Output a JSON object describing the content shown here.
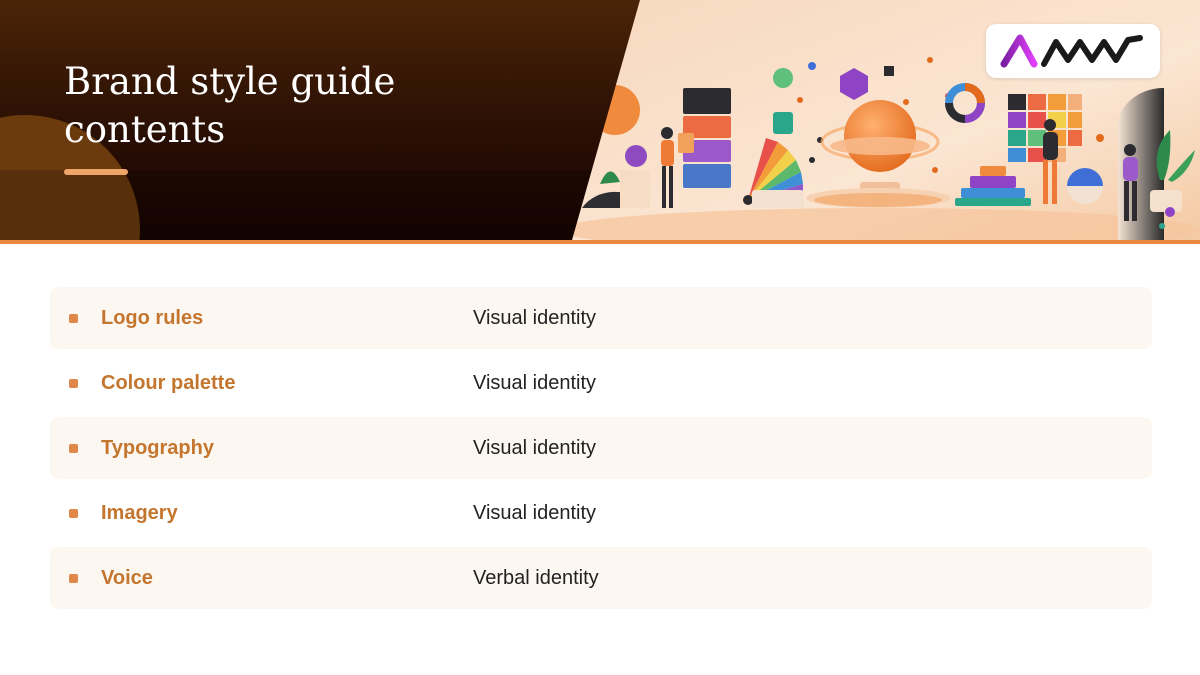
{
  "header": {
    "title": "Brand style guide contents",
    "logo_text": "AMW"
  },
  "rows": [
    {
      "label": "Logo rules",
      "value": "Visual identity"
    },
    {
      "label": "Colour palette",
      "value": "Visual identity"
    },
    {
      "label": "Typography",
      "value": "Visual identity"
    },
    {
      "label": "Imagery",
      "value": "Visual identity"
    },
    {
      "label": "Voice",
      "value": "Verbal identity"
    }
  ],
  "colors": {
    "accent": "#e8873e",
    "label_text": "#c4762f",
    "row_shade": "#fdf7f1",
    "banner_dark": "#2a0f04"
  },
  "icons": [
    "decorative-illustration",
    "brand-logo"
  ]
}
